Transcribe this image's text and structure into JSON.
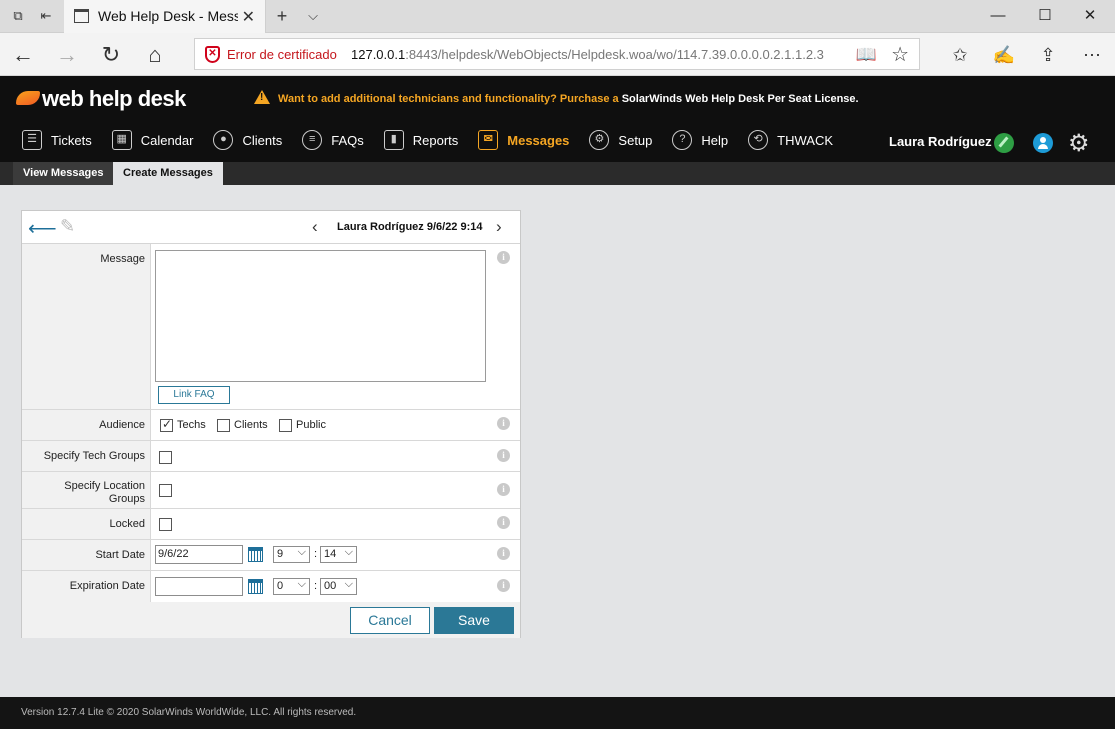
{
  "browser": {
    "tab_title": "Web Help Desk - Messa",
    "cert_error": "Error de certificado",
    "url_host": "127.0.0.1",
    "url_rest": ":8443/helpdesk/WebObjects/Helpdesk.woa/wo/114.7.39.0.0.0.0.2.1.1.2.3"
  },
  "app": {
    "logo": "web help desk",
    "promo_orange": "Want to add additional technicians and functionality? Purchase a",
    "promo_white": "SolarWinds Web Help Desk Per Seat License.",
    "user_name": "Laura Rodríguez",
    "nav": [
      {
        "label": "Tickets",
        "icon": "list-icon"
      },
      {
        "label": "Calendar",
        "icon": "calendar-icon"
      },
      {
        "label": "Clients",
        "icon": "person-icon"
      },
      {
        "label": "FAQs",
        "icon": "faq-icon"
      },
      {
        "label": "Reports",
        "icon": "report-icon"
      },
      {
        "label": "Messages",
        "icon": "envelope-icon"
      },
      {
        "label": "Setup",
        "icon": "gear-icon"
      },
      {
        "label": "Help",
        "icon": "help-icon"
      },
      {
        "label": "THWACK",
        "icon": "thwack-icon"
      }
    ],
    "subtabs": [
      "View Messages",
      "Create Messages"
    ]
  },
  "form": {
    "record_info": "Laura Rodríguez 9/6/22 9:14",
    "message_label": "Message",
    "message_value": "",
    "link_faq": "Link FAQ",
    "audience_label": "Audience",
    "audience_options": [
      {
        "label": "Techs",
        "checked": true
      },
      {
        "label": "Clients",
        "checked": false
      },
      {
        "label": "Public",
        "checked": false
      }
    ],
    "tech_groups_label": "Specify Tech Groups",
    "location_groups_label_1": "Specify Location",
    "location_groups_label_2": "Groups",
    "locked_label": "Locked",
    "start_date_label": "Start Date",
    "start_date": "9/6/22",
    "start_hour": "9",
    "start_min": "14",
    "expiration_date_label": "Expiration Date",
    "expiration_date": "",
    "exp_hour": "0",
    "exp_min": "00",
    "cancel": "Cancel",
    "save": "Save"
  },
  "footer": "Version 12.7.4 Lite © 2020 SolarWinds WorldWide, LLC. All rights reserved."
}
